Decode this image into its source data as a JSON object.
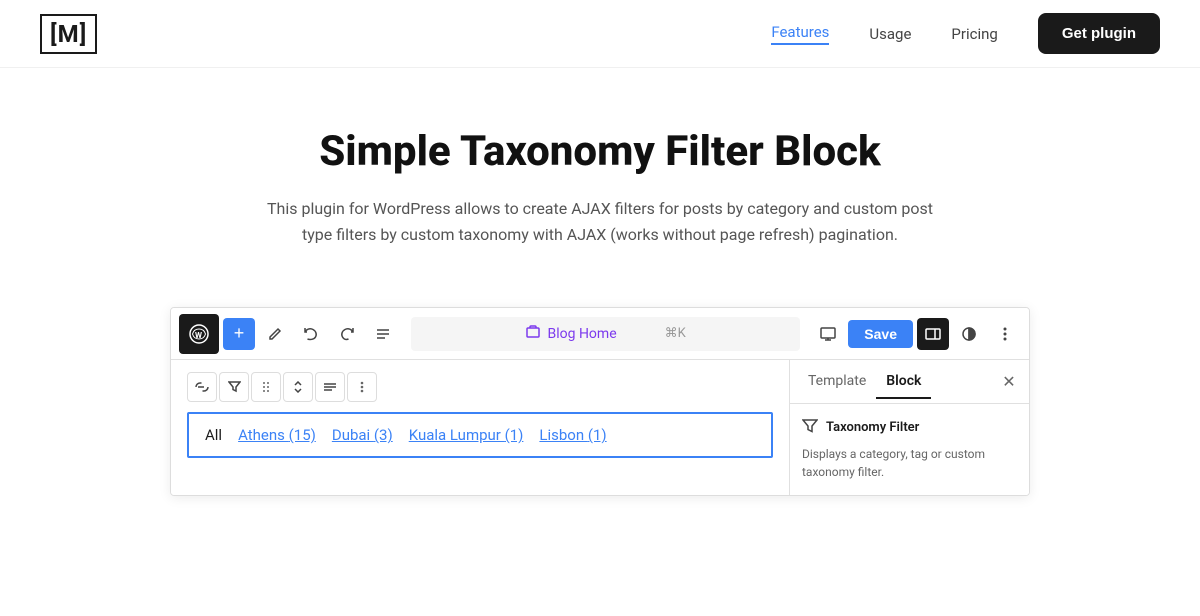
{
  "header": {
    "logo": "[M]",
    "nav": {
      "features_label": "Features",
      "usage_label": "Usage",
      "pricing_label": "Pricing",
      "get_plugin_label": "Get plugin"
    }
  },
  "hero": {
    "title": "Simple Taxonomy Filter Block",
    "description": "This plugin for WordPress allows to create AJAX filters for posts by category and custom post type filters by custom taxonomy with AJAX (works without page refresh) pagination."
  },
  "editor": {
    "toolbar": {
      "add_icon": "+",
      "pencil_icon": "✏",
      "undo_icon": "↩",
      "redo_icon": "↪",
      "list_icon": "≡",
      "address_label": "Blog Home",
      "shortcut_label": "⌘K",
      "save_label": "Save"
    },
    "block_toolbar": {
      "link_icon": "∞",
      "filter_icon": "⌥",
      "drag_icon": "⠿",
      "arrows_icon": "⇅",
      "align_icon": "≡",
      "more_icon": "⋮"
    },
    "filter_block": {
      "items": [
        {
          "label": "All",
          "count": null,
          "is_all": true
        },
        {
          "label": "Athens",
          "count": "(15)"
        },
        {
          "label": "Dubai",
          "count": "(3)"
        },
        {
          "label": "Kuala Lumpur",
          "count": "(1)"
        },
        {
          "label": "Lisbon",
          "count": "(1)"
        }
      ]
    },
    "panel": {
      "tab_template": "Template",
      "tab_block": "Block",
      "block_title": "Taxonomy Filter",
      "block_description": "Displays a category, tag or custom taxonomy filter."
    }
  }
}
